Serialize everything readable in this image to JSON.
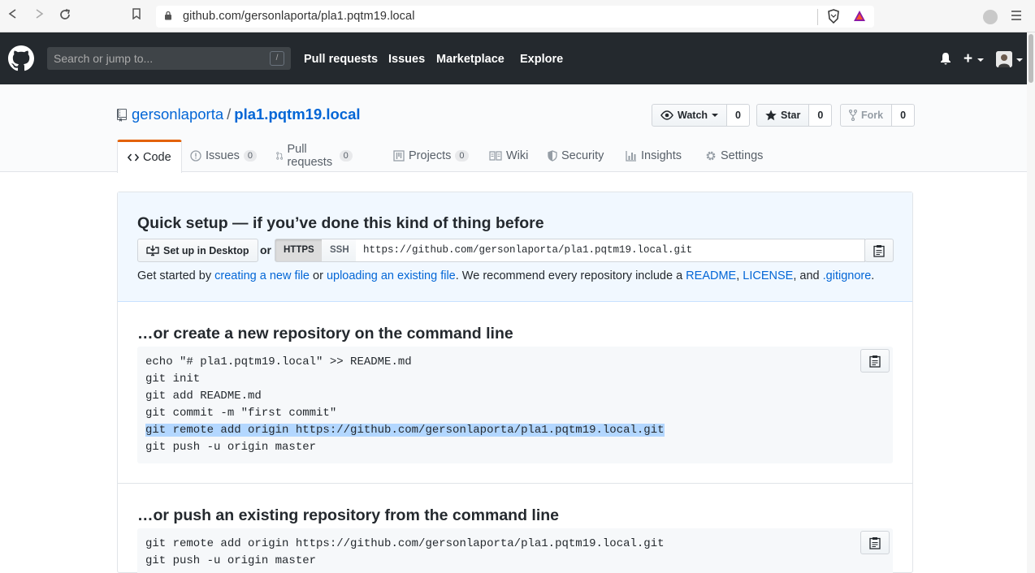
{
  "browser": {
    "url": "github.com/gersonlaporta/pla1.pqtm19.local"
  },
  "header": {
    "search_placeholder": "Search or jump to...",
    "search_shortcut": "/",
    "nav": [
      "Pull requests",
      "Issues",
      "Marketplace",
      "Explore"
    ]
  },
  "repo": {
    "owner": "gersonlaporta",
    "separator": "/",
    "name": "pla1.pqtm19.local",
    "watch_label": "Watch",
    "watch_count": "0",
    "star_label": "Star",
    "star_count": "0",
    "fork_label": "Fork",
    "fork_count": "0"
  },
  "tabs": [
    {
      "label": "Code",
      "icon": "code-icon"
    },
    {
      "label": "Issues",
      "counter": "0",
      "icon": "issue-icon"
    },
    {
      "label": "Pull requests",
      "counter": "0",
      "icon": "pull-request-icon"
    },
    {
      "label": "Projects",
      "counter": "0",
      "icon": "project-icon"
    },
    {
      "label": "Wiki",
      "icon": "book-icon"
    },
    {
      "label": "Security",
      "icon": "shield-icon"
    },
    {
      "label": "Insights",
      "icon": "graph-icon"
    },
    {
      "label": "Settings",
      "icon": "gear-icon"
    }
  ],
  "quick_setup": {
    "title": "Quick setup — if you’ve done this kind of thing before",
    "desktop_label": "Set up in Desktop",
    "or": "or",
    "https": "HTTPS",
    "ssh": "SSH",
    "clone_url": "https://github.com/gersonlaporta/pla1.pqtm19.local.git",
    "help": {
      "t1": "Get started by ",
      "l1": "creating a new file",
      "t2": " or ",
      "l2": "uploading an existing file",
      "t3": ". We recommend every repository include a ",
      "l3": "README",
      "t4": ", ",
      "l4": "LICENSE",
      "t5": ", and ",
      "l5": ".gitignore",
      "t6": "."
    }
  },
  "new_repo": {
    "title": "…or create a new repository on the command line",
    "lines": [
      "echo \"# pla1.pqtm19.local\" >> README.md",
      "git init",
      "git add README.md",
      "git commit -m \"first commit\"",
      "git remote add origin https://github.com/gersonlaporta/pla1.pqtm19.local.git",
      "git push -u origin master"
    ],
    "selected_line": 4
  },
  "push_existing": {
    "title": "…or push an existing repository from the command line",
    "lines": [
      "git remote add origin https://github.com/gersonlaporta/pla1.pqtm19.local.git",
      "git push -u origin master"
    ]
  },
  "colors": {
    "header_bg": "#24292e",
    "link": "#0366d6",
    "tab_accent": "#e36209",
    "quick_setup_bg": "#f1f8ff",
    "selection": "#b3d7ff"
  }
}
